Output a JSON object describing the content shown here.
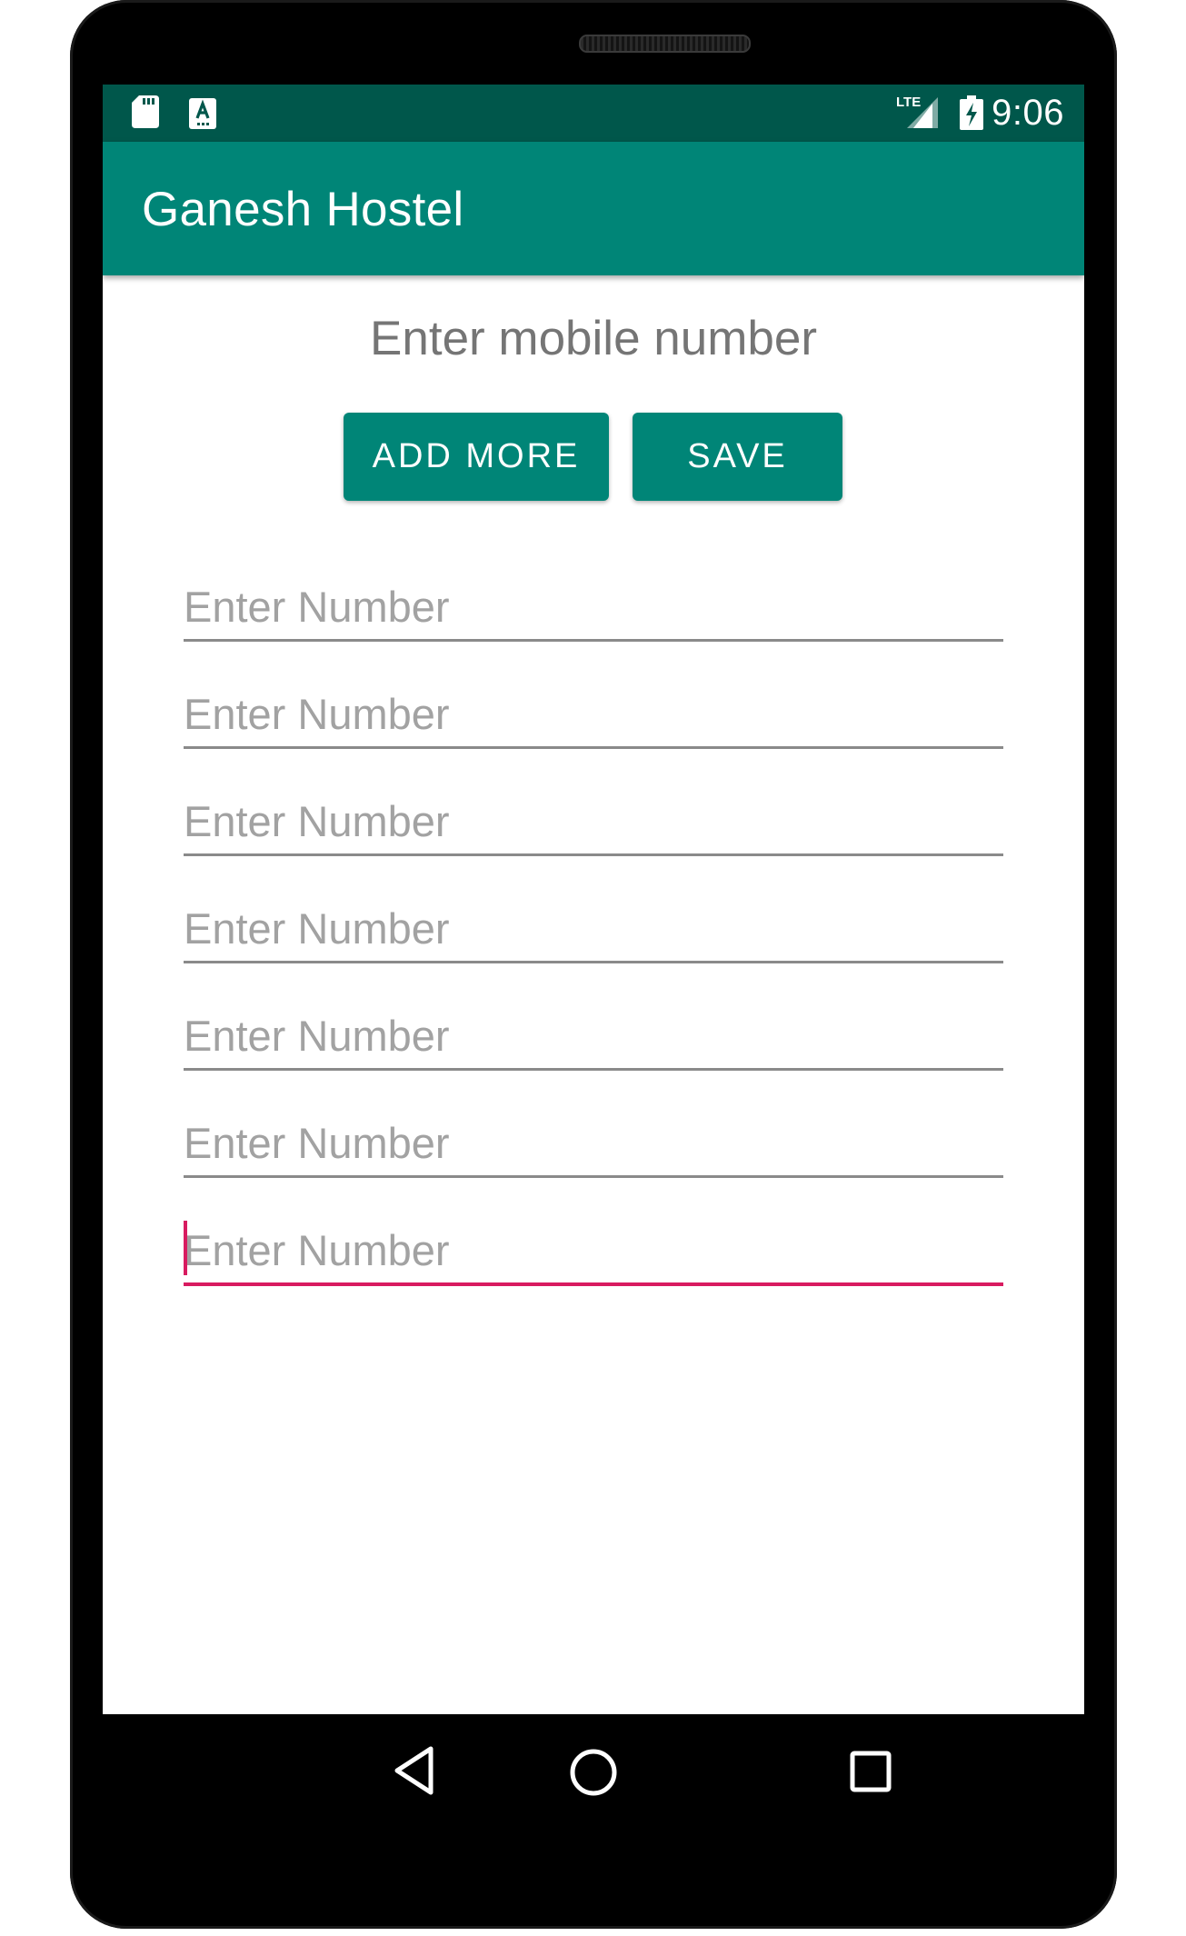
{
  "status_bar": {
    "time": "9:06",
    "network": "LTE",
    "icons": [
      "sd-card-icon",
      "keyboard-a-icon",
      "lte-signal-icon",
      "battery-charging-icon"
    ]
  },
  "app_bar": {
    "title": "Ganesh Hostel"
  },
  "main": {
    "heading": "Enter mobile number",
    "add_more_label": "ADD MORE",
    "save_label": "SAVE",
    "fields": [
      {
        "placeholder": "Enter Number",
        "value": "",
        "focused": false
      },
      {
        "placeholder": "Enter Number",
        "value": "",
        "focused": false
      },
      {
        "placeholder": "Enter Number",
        "value": "",
        "focused": false
      },
      {
        "placeholder": "Enter Number",
        "value": "",
        "focused": false
      },
      {
        "placeholder": "Enter Number",
        "value": "",
        "focused": false
      },
      {
        "placeholder": "Enter Number",
        "value": "",
        "focused": false
      },
      {
        "placeholder": "Enter Number",
        "value": "",
        "focused": true
      }
    ]
  },
  "nav_bar": {
    "buttons": [
      "back-icon",
      "home-icon",
      "recents-icon"
    ]
  },
  "colors": {
    "primary": "#008577",
    "primary_dark": "#00574b",
    "accent": "#d81b60",
    "heading_text": "#757575",
    "hint_text": "#a2a2a2"
  }
}
